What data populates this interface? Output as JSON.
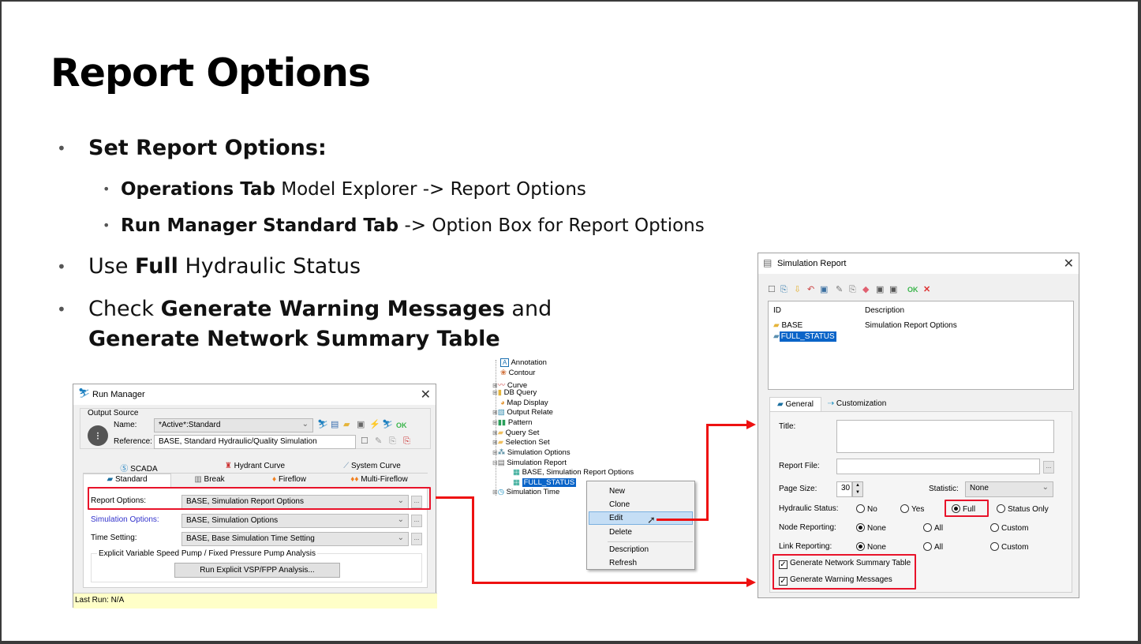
{
  "slide": {
    "title": "Report Options",
    "bullets": [
      {
        "bold": "Set Report Options:",
        "rest": ""
      },
      {
        "bold": "Operations Tab",
        "rest": " Model Explorer -> Report Options"
      },
      {
        "bold": "Run Manager Standard Tab",
        "rest": " -> Option Box for Report Options"
      },
      {
        "pre": "Use ",
        "bold": "Full",
        "rest": " Hydraulic Status"
      },
      {
        "pre": "Check ",
        "bold": "Generate Warning Messages",
        "rest": " and"
      },
      {
        "bold": "Generate Network Summary Table",
        "rest": ""
      }
    ],
    "accent_color": "#e8132a"
  },
  "run_manager": {
    "title": "Run Manager",
    "output_source_label": "Output Source",
    "name_label": "Name:",
    "name_value": "*Active*:Standard",
    "reference_label": "Reference:",
    "reference_value": "BASE, Standard Hydraulic/Quality Simulation",
    "ok_label": "OK",
    "tabs_row1": [
      "SCADA",
      "Hydrant Curve",
      "System Curve"
    ],
    "tabs_row2": [
      "Standard",
      "Break",
      "Fireflow",
      "Multi-Fireflow"
    ],
    "active_tab": "Standard",
    "report_options_label": "Report Options:",
    "report_options_value": "BASE, Simulation Report Options",
    "simulation_options_label": "Simulation Options:",
    "simulation_options_value": "BASE, Simulation Options",
    "time_setting_label": "Time Setting:",
    "time_setting_value": "BASE, Base Simulation Time Setting",
    "explicit_group_label": "Explicit Variable Speed Pump / Fixed Pressure Pump Analysis",
    "run_explicit_button": "Run Explicit VSP/FPP Analysis...",
    "status": "Last Run: N/A"
  },
  "model_explorer": {
    "items": [
      {
        "label": "Annotation",
        "icon": "annotation-icon"
      },
      {
        "label": "Contour",
        "icon": "contour-icon"
      },
      {
        "label": "Curve",
        "icon": "curve-icon"
      },
      {
        "label": "DB Query",
        "icon": "db-query-icon"
      },
      {
        "label": "Map Display",
        "icon": "map-display-icon"
      },
      {
        "label": "Output Relate",
        "icon": "output-relate-icon"
      },
      {
        "label": "Pattern",
        "icon": "pattern-icon"
      },
      {
        "label": "Query Set",
        "icon": "query-set-icon"
      },
      {
        "label": "Selection Set",
        "icon": "selection-set-icon"
      },
      {
        "label": "Simulation Options",
        "icon": "simulation-options-icon"
      },
      {
        "label": "Simulation Report",
        "icon": "simulation-report-icon"
      },
      {
        "label": "BASE, Simulation Report Options",
        "icon": "report-item-icon"
      },
      {
        "label": "FULL_STATUS",
        "icon": "report-item-icon",
        "selected": true
      },
      {
        "label": "Simulation Time",
        "icon": "simulation-time-icon"
      }
    ],
    "context_menu": [
      "New",
      "Clone",
      "Edit",
      "Delete",
      "Description",
      "Refresh"
    ],
    "highlighted_menu_item": "Edit"
  },
  "simulation_report": {
    "title": "Simulation Report",
    "ok_label": "OK",
    "columns": [
      "ID",
      "Description"
    ],
    "rows": [
      {
        "id": "BASE",
        "description": "Simulation Report Options"
      },
      {
        "id": "FULL_STATUS",
        "description": "",
        "selected": true
      }
    ],
    "tabs": [
      "General",
      "Customization"
    ],
    "title_label": "Title:",
    "title_value": "",
    "report_file_label": "Report File:",
    "report_file_value": "",
    "page_size_label": "Page Size:",
    "page_size_value": "30",
    "statistic_label": "Statistic:",
    "statistic_value": "None",
    "hydraulic_status_label": "Hydraulic Status:",
    "hydraulic_status_options": [
      "No",
      "Yes",
      "Full",
      "Status Only"
    ],
    "hydraulic_status_selected": "Full",
    "node_reporting_label": "Node Reporting:",
    "link_reporting_label": "Link Reporting:",
    "reporting_options": [
      "None",
      "All",
      "Custom"
    ],
    "node_reporting_selected": "None",
    "link_reporting_selected": "None",
    "generate_network_summary": "Generate Network Summary Table",
    "generate_network_summary_checked": true,
    "generate_warning_messages": "Generate Warning Messages",
    "generate_warning_messages_checked": true
  }
}
